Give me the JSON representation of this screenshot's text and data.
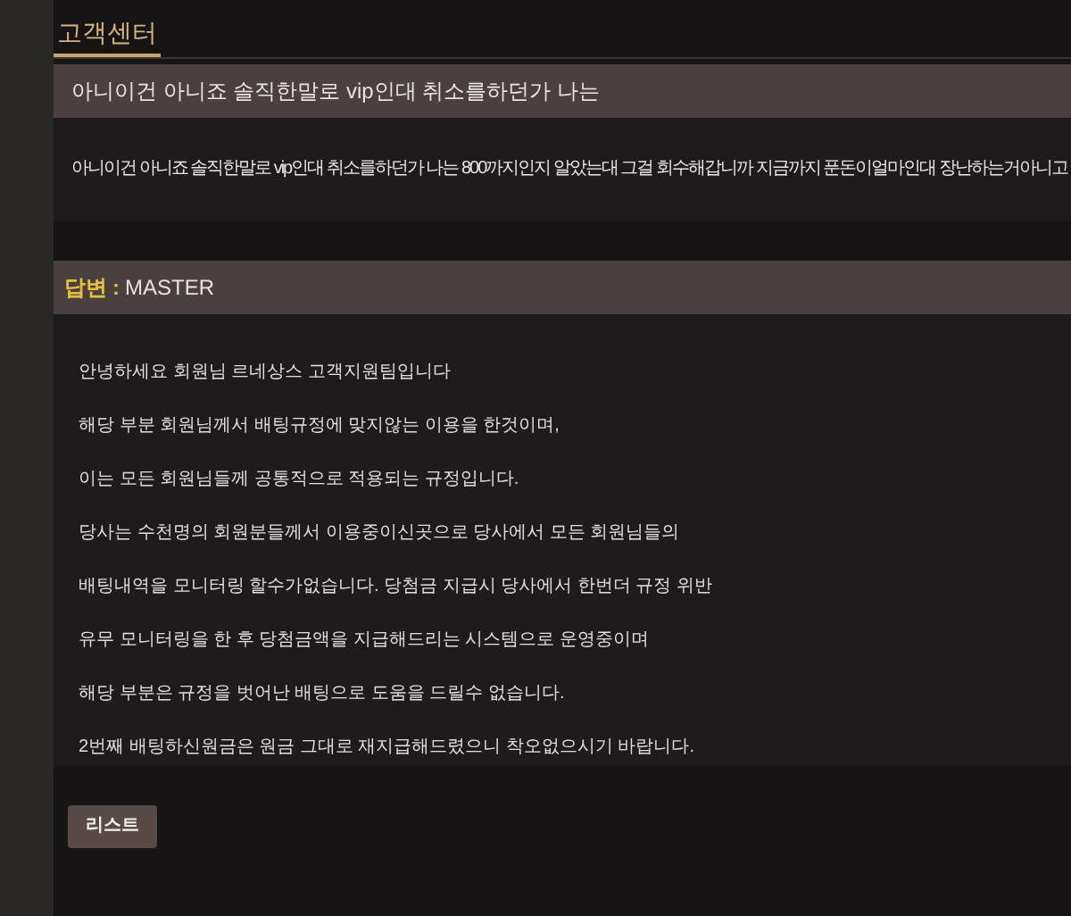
{
  "page_title": "고객센터",
  "question": {
    "title": "아니이건 아니죠 솔직한말로 vip인대 취소를하던가 나는",
    "body": "아니이건 아니죠 솔직한말로 vip인대 취소를하던가 나는 800까지인지 알았는대 그걸 회수해갑니까 지금까지 푼돈이얼마인대 장난하는거아니고"
  },
  "answer": {
    "label": "답변",
    "separator": ":",
    "author": "MASTER",
    "lines": [
      "안녕하세요 회원님 르네상스 고객지원팀입니다",
      "해당 부분 회원님께서 배팅규정에 맞지않는 이용을 한것이며,",
      "이는 모든 회원님들께 공통적으로 적용되는 규정입니다.",
      "당사는 수천명의 회원분들께서 이용중이신곳으로 당사에서 모든 회원님들의",
      "배팅내역을 모니터링 할수가없습니다. 당첨금 지급시 당사에서 한번더 규정 위반",
      "유무 모니터링을 한 후 당첨금액을 지급해드리는 시스템으로 운영중이며",
      "해당 부분은 규정을 벗어난 배팅으로 도움을 드릴수 없습니다.",
      "2번째 배팅하신원금은 원금 그대로 재지급해드렸으니 착오없으시기 바랍니다."
    ]
  },
  "list_button": "리스트"
}
